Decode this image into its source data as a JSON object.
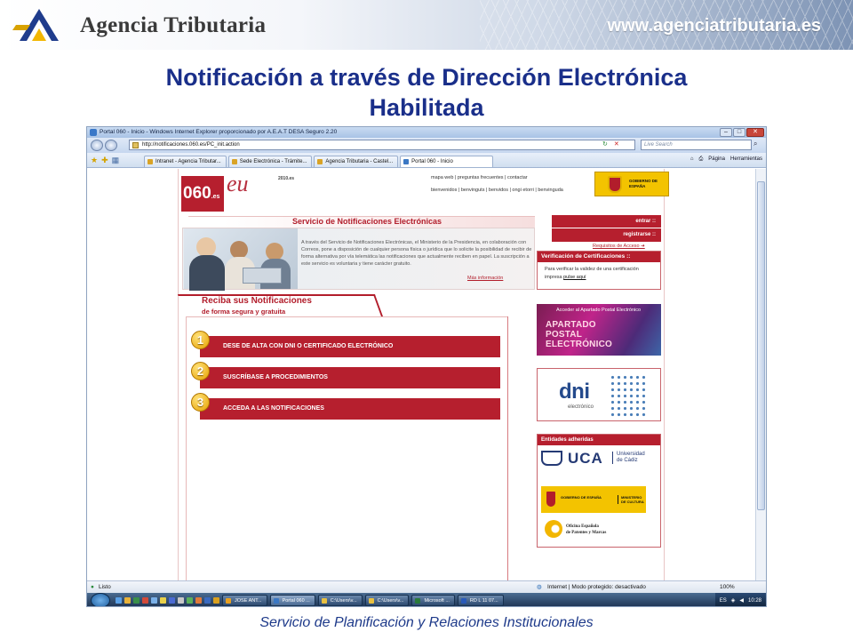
{
  "header": {
    "title": "Agencia Tributaria",
    "url": "www.agenciatributaria.es"
  },
  "slide": {
    "title_line1": "Notificación a través de Dirección Electrónica",
    "title_line2": "Habilitada",
    "footer": "Servicio de Planificación y Relaciones Institucionales"
  },
  "browser": {
    "window_title": "Portal 060 - Inicio - Windows Internet Explorer proporcionado por A.E.A.T DESA Seguro 2.20",
    "address": "http://notificaciones.060.es/PC_init.action",
    "search_placeholder": "Live Search",
    "tabs": [
      {
        "label": "Intranet - Agencia Tributar..."
      },
      {
        "label": "Sede Electrónica - Trámite..."
      },
      {
        "label": "Agencia Tributaria - Castel..."
      },
      {
        "label": "Portal 060 - Inicio"
      }
    ],
    "tools": {
      "page": "Página",
      "tools": "Herramientas"
    },
    "status": {
      "left": "Listo",
      "zone": "Internet | Modo protegido: desactivado",
      "zoom": "100%"
    }
  },
  "taskbar": {
    "tasks": [
      {
        "label": "JOSE ANT..."
      },
      {
        "label": "Portal 060 ..."
      },
      {
        "label": "C:\\Users\\v..."
      },
      {
        "label": "C:\\Users\\v..."
      },
      {
        "label": "Microsoft ..."
      },
      {
        "label": "RD L 11 07..."
      }
    ],
    "lang": "ES",
    "clock": "10:28"
  },
  "page060": {
    "logo": "060",
    "logo_suffix": ".es",
    "eu": "eu",
    "year": "2010.es",
    "links": "mapa web | preguntas frecuentes | contactar",
    "languages": "bienvenidos | benvinguts | benvidos | ongi etorri | benvinguda",
    "gobierno": "GOBIERNO DE ESPAÑA",
    "service_title": "Servicio de Notificaciones Electrónicas",
    "service_text": "A través del Servicio de Notificaciones Electrónicas, el Ministerio de la Presidencia, en colaboración con Correos, pone a disposición de cualquier persona física o jurídica que lo solicite la posibilidad de recibir de forma alternativa por vía telemática las notificaciones que actualmente reciben en papel. La suscripción a este servicio es voluntaria y tiene carácter gratuito.",
    "more_info": "Más información",
    "receive_title": "Reciba sus Notificaciones",
    "receive_sub": "de forma segura y gratuita",
    "steps": [
      {
        "num": "1",
        "label": "DESE DE ALTA CON DNI O CERTIFICADO ELECTRÓNICO"
      },
      {
        "num": "2",
        "label": "SUSCRÍBASE A PROCEDIMIENTOS"
      },
      {
        "num": "3",
        "label": "ACCEDA A LAS NOTIFICACIONES"
      }
    ],
    "enter": "entrar ::",
    "register": "registrarse ::",
    "access_req": "Requisitos de Acceso ➜",
    "verif_title": "Verificación de Certificaciones ::",
    "verif_text_1": "Para verificar la validez de una certificación",
    "verif_text_2": "impresa",
    "verif_link": "pulse aquí",
    "apartado_header": "Acceder al Apartado Postal Electrónico",
    "apartado_l1": "APARTADO",
    "apartado_l2": "POSTAL",
    "apartado_l3": "ELECTRÓNICO",
    "dni": "dni",
    "dni_sub": "electrónico",
    "entities_title": "Entidades adheridas",
    "uca": "UCA",
    "uca_name_1": "Universidad",
    "uca_name_2": "de Cádiz",
    "gob_small": "GOBIERNO DE ESPAÑA",
    "ministerio": "MINISTERIO DE CULTURA",
    "oepm_1": "Oficina Española",
    "oepm_2": "de Patentes y Marcas"
  }
}
